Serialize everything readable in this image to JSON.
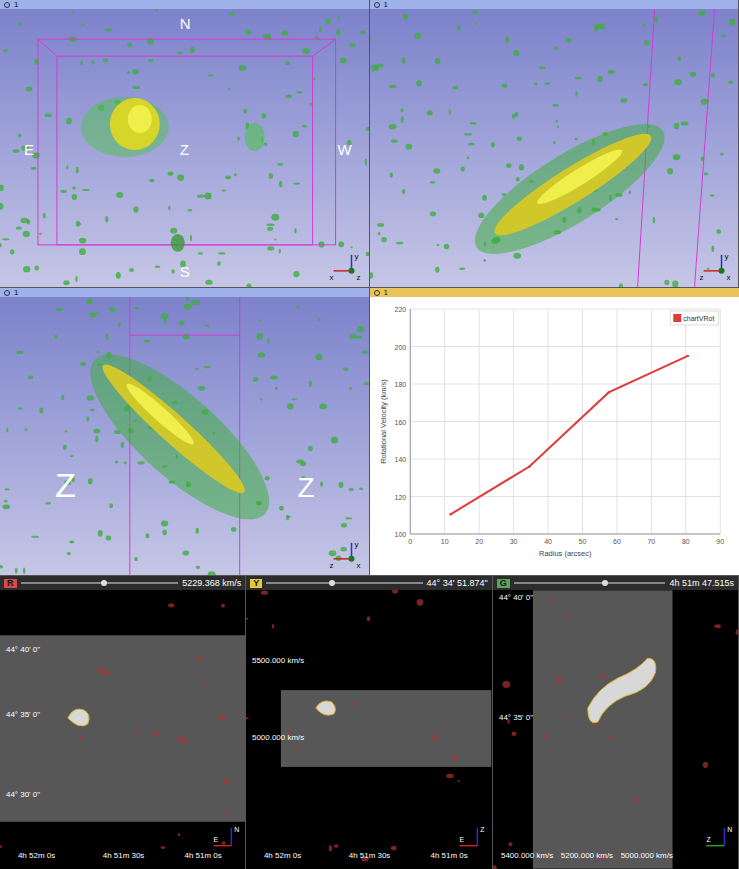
{
  "views3d": [
    {
      "header_label": "1",
      "axes": [
        "y",
        "x",
        "z"
      ],
      "compass": {
        "north": "N",
        "south": "S",
        "east": "E",
        "west": "W",
        "center": "Z"
      }
    },
    {
      "header_label": "1",
      "axes": [
        "y",
        "z",
        "x"
      ]
    },
    {
      "header_label": "1",
      "axes": [
        "y",
        "z",
        "x"
      ],
      "side_labels": {
        "left": "Z",
        "right": "Z"
      }
    }
  ],
  "chart": {
    "header_label": "1",
    "legend": "chartVRot",
    "y_axis_title": "Rotational Velocity (km/s)",
    "x_axis_title": "Radius (arcsec)",
    "y_ticks": [
      "100",
      "120",
      "140",
      "160",
      "180",
      "200",
      "220"
    ],
    "x_ticks": [
      "0",
      "10",
      "20",
      "30",
      "40",
      "50",
      "60",
      "70",
      "80",
      "90"
    ],
    "series": [
      {
        "name": "chartVRot",
        "color": "#e03a3a",
        "x": [
          11.7,
          34.6,
          57.6,
          80.6
        ],
        "y": [
          110.5,
          136,
          175.5,
          195
        ]
      }
    ]
  },
  "slices": [
    {
      "letter": "R",
      "color": "#d84a4a",
      "value": "5229.368 km/s",
      "level": 0.53,
      "left_ticks": [
        "44° 40' 0\"",
        "44° 35' 0\"",
        "44° 30' 0\""
      ],
      "bottom_ticks": [
        "4h 52m 0s",
        "4h 51m 30s",
        "4h 51m 0s"
      ],
      "axes": [
        "N",
        "E"
      ]
    },
    {
      "letter": "Y",
      "color": "#e6c73a",
      "value": "44° 34' 51.874\"",
      "level": 0.42,
      "left_ticks": [
        "5500.000 km/s",
        "5000.000 km/s"
      ],
      "bottom_ticks": [
        "4h 52m 0s",
        "4h 51m 30s",
        "4h 51m 0s"
      ],
      "axes": [
        "Z",
        "E"
      ]
    },
    {
      "letter": "G",
      "color": "#5aa55a",
      "value": "4h 51m 47.515s",
      "level": 0.6,
      "left_ticks": [
        "44° 40' 0\"",
        "44° 35' 0\""
      ],
      "bottom_ticks": [
        "5400.000 km/s",
        "5200.000 km/s",
        "5000.000 km/s"
      ],
      "axes": [
        "N",
        "Z"
      ]
    }
  ]
}
